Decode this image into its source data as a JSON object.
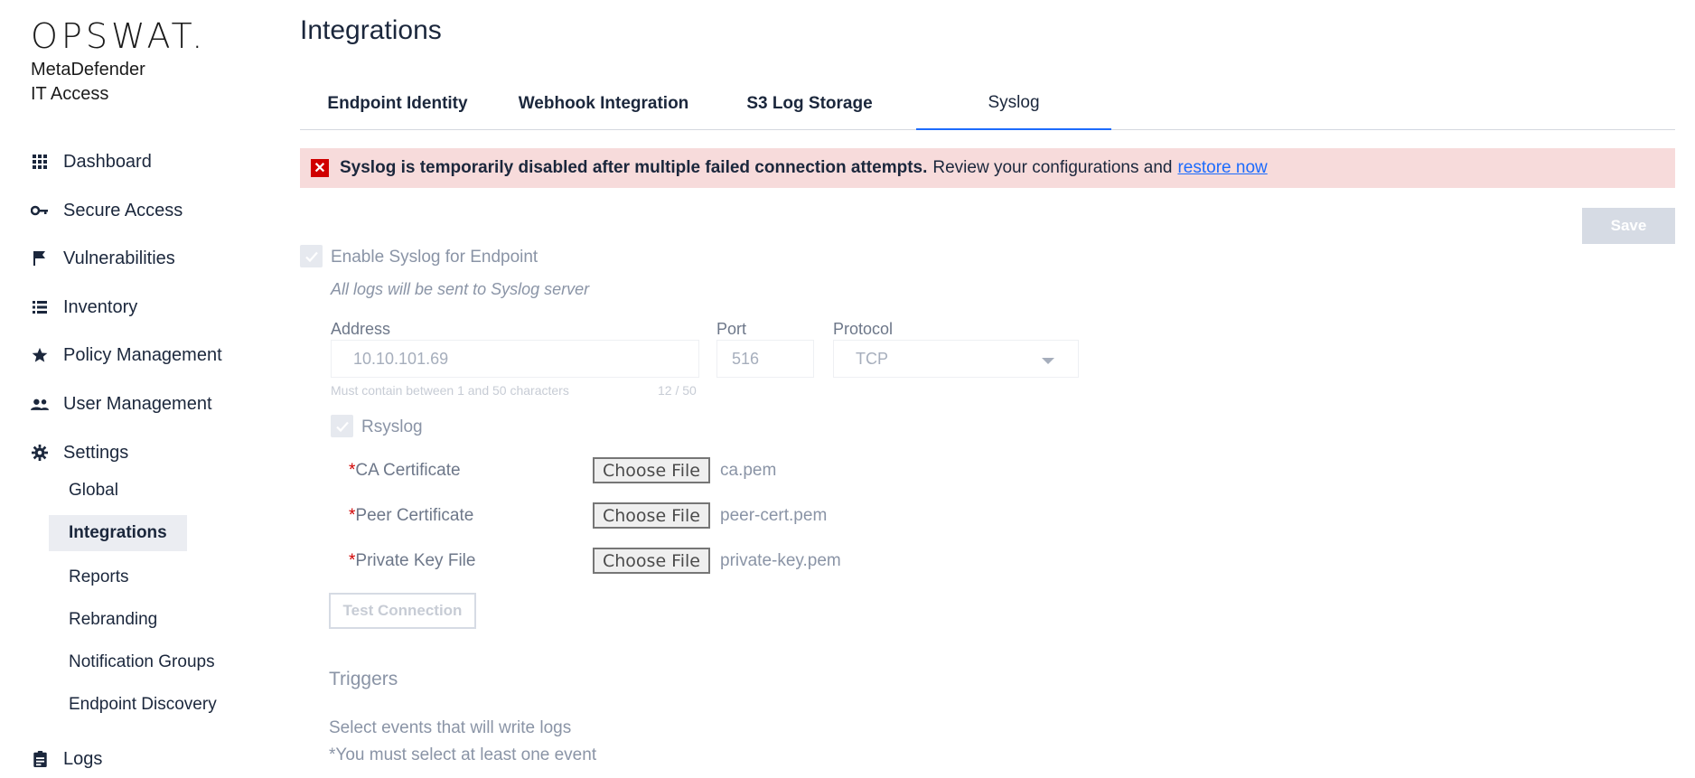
{
  "brand": {
    "logo": "OPSWAT.",
    "product_line1": "MetaDefender",
    "product_line2": "IT Access"
  },
  "sidebar": {
    "items": [
      {
        "label": "Dashboard",
        "icon": "grid-icon"
      },
      {
        "label": "Secure Access",
        "icon": "key-icon"
      },
      {
        "label": "Vulnerabilities",
        "icon": "flag-icon"
      },
      {
        "label": "Inventory",
        "icon": "list-icon"
      },
      {
        "label": "Policy Management",
        "icon": "star-icon"
      },
      {
        "label": "User Management",
        "icon": "people-icon"
      },
      {
        "label": "Settings",
        "icon": "gear-icon"
      },
      {
        "label": "Logs",
        "icon": "clipboard-icon"
      }
    ],
    "settings_sub": [
      {
        "label": "Global"
      },
      {
        "label": "Integrations",
        "active": true
      },
      {
        "label": "Reports"
      },
      {
        "label": "Rebranding"
      },
      {
        "label": "Notification Groups"
      },
      {
        "label": "Endpoint Discovery"
      }
    ]
  },
  "page": {
    "title": "Integrations"
  },
  "tabs": [
    {
      "label": "Endpoint Identity"
    },
    {
      "label": "Webhook Integration"
    },
    {
      "label": "S3 Log Storage"
    },
    {
      "label": "Syslog",
      "active": true
    }
  ],
  "alert": {
    "strong": "Syslog is temporarily disabled after multiple failed connection attempts.",
    "rest": "Review your configurations and",
    "link": "restore now"
  },
  "toolbar": {
    "save_label": "Save"
  },
  "form": {
    "enable_label": "Enable Syslog for Endpoint",
    "enable_checked": true,
    "enable_hint": "All logs will be sent to Syslog server",
    "address_label": "Address",
    "address_value": "10.10.101.69",
    "address_hint": "Must contain between 1 and 50 characters",
    "address_count": "12 / 50",
    "port_label": "Port",
    "port_value": "516",
    "protocol_label": "Protocol",
    "protocol_value": "TCP",
    "rsyslog_label": "Rsyslog",
    "rsyslog_checked": true,
    "certs": [
      {
        "label": "CA Certificate",
        "button": "Choose File",
        "file": "ca.pem"
      },
      {
        "label": "Peer Certificate",
        "button": "Choose File",
        "file": "peer-cert.pem"
      },
      {
        "label": "Private Key File",
        "button": "Choose File",
        "file": "private-key.pem"
      }
    ],
    "required_mark": "*",
    "test_connection_label": "Test Connection"
  },
  "triggers": {
    "title": "Triggers",
    "description": "Select events that will write logs",
    "note": "*You must select at least one event"
  },
  "colors": {
    "accent": "#1d6bfc",
    "error": "#d00000",
    "alert_bg": "#f7dbdb"
  }
}
